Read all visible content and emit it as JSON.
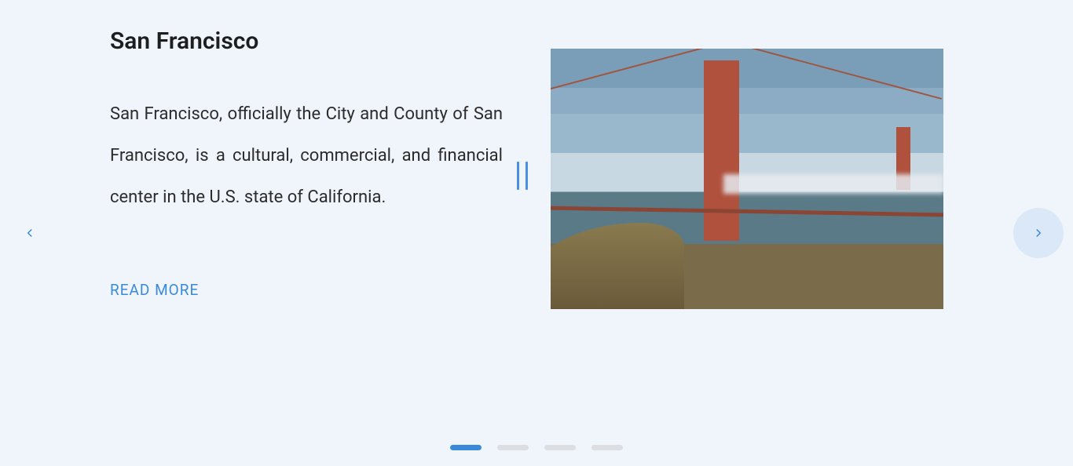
{
  "carousel": {
    "slides": [
      {
        "title": "San Francisco",
        "description": "San Francisco, officially the City and County of San Francisco, is a cultural, commercial, and financial center in the U.S. state of California.",
        "cta_label": "READ MORE",
        "image_alt": "Golden Gate Bridge"
      }
    ],
    "active_index": 0,
    "total_slides": 4,
    "paused": true
  },
  "icons": {
    "prev": "chevron-left",
    "next": "chevron-right",
    "pause": "pause"
  },
  "colors": {
    "accent": "#3b8ad9",
    "background": "#f0f5fb",
    "dot_inactive": "#dcdee2",
    "nav_hover_bg": "#dae8f7"
  }
}
